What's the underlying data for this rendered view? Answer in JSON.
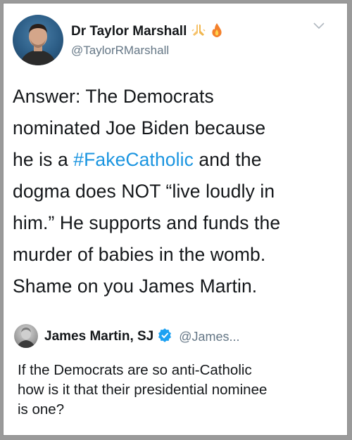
{
  "tweet": {
    "author_name": "Dr Taylor Marshall",
    "author_emojis": [
      "folded-hands-emoji",
      "fire-emoji"
    ],
    "author_handle": "@TaylorRMarshall",
    "lines": [
      {
        "pre": "Answer: The Democrats",
        "tag": "",
        "post": ""
      },
      {
        "pre": "nominated Joe Biden because",
        "tag": "",
        "post": ""
      },
      {
        "pre": "he is a ",
        "tag": "#FakeCatholic",
        "post": " and the"
      },
      {
        "pre": "dogma does NOT “live loudly in",
        "tag": "",
        "post": ""
      },
      {
        "pre": "him.” He supports and funds the",
        "tag": "",
        "post": ""
      },
      {
        "pre": "murder of babies in the womb.",
        "tag": "",
        "post": ""
      },
      {
        "pre": "Shame on you James Martin.",
        "tag": "",
        "post": ""
      }
    ]
  },
  "quoted_tweet": {
    "author_name": "James Martin, SJ",
    "verified_icon": "verified-badge-icon",
    "author_handle": "@James...",
    "lines": [
      "If the Democrats are so anti-Catholic",
      "how is it that their presidential nominee",
      "is one?"
    ]
  },
  "icons": {
    "menu": "chevron-down-icon"
  },
  "colors": {
    "text": "#14171a",
    "secondary": "#657786",
    "link": "#1b95e0",
    "verified": "#1da1f2"
  }
}
